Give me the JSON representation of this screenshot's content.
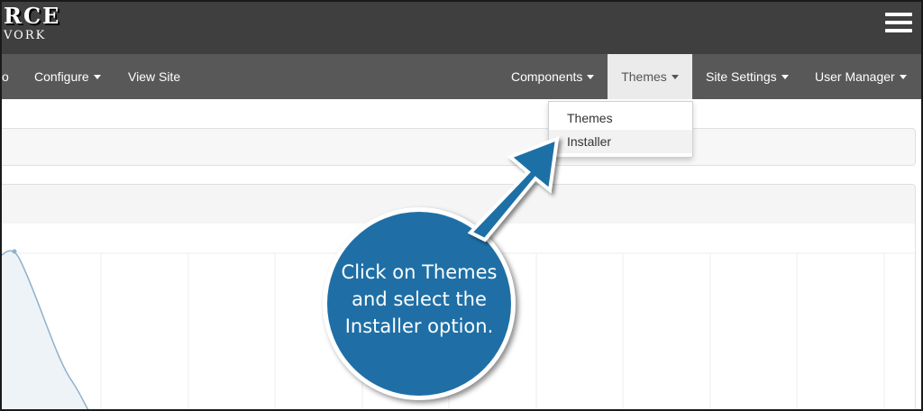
{
  "header": {
    "logo_line1": "RCE",
    "logo_line2": "VORK"
  },
  "nav": {
    "partial_item": "o",
    "items_left": [
      {
        "label": "Configure"
      },
      {
        "label": "View Site"
      }
    ],
    "items_right": [
      {
        "label": "Components"
      },
      {
        "label": "Themes"
      },
      {
        "label": "Site Settings"
      },
      {
        "label": "User Manager"
      }
    ]
  },
  "dropdown": {
    "items": [
      {
        "label": "Themes"
      },
      {
        "label": "Installer"
      }
    ]
  },
  "callout": {
    "text": "Click on Themes and select the Installer option.",
    "color": "#1f6fa6"
  },
  "colors": {
    "topbar": "#3f3f3f",
    "navbar": "#585858",
    "active_tab": "#ebebeb",
    "accent": "#1f6fa6"
  }
}
